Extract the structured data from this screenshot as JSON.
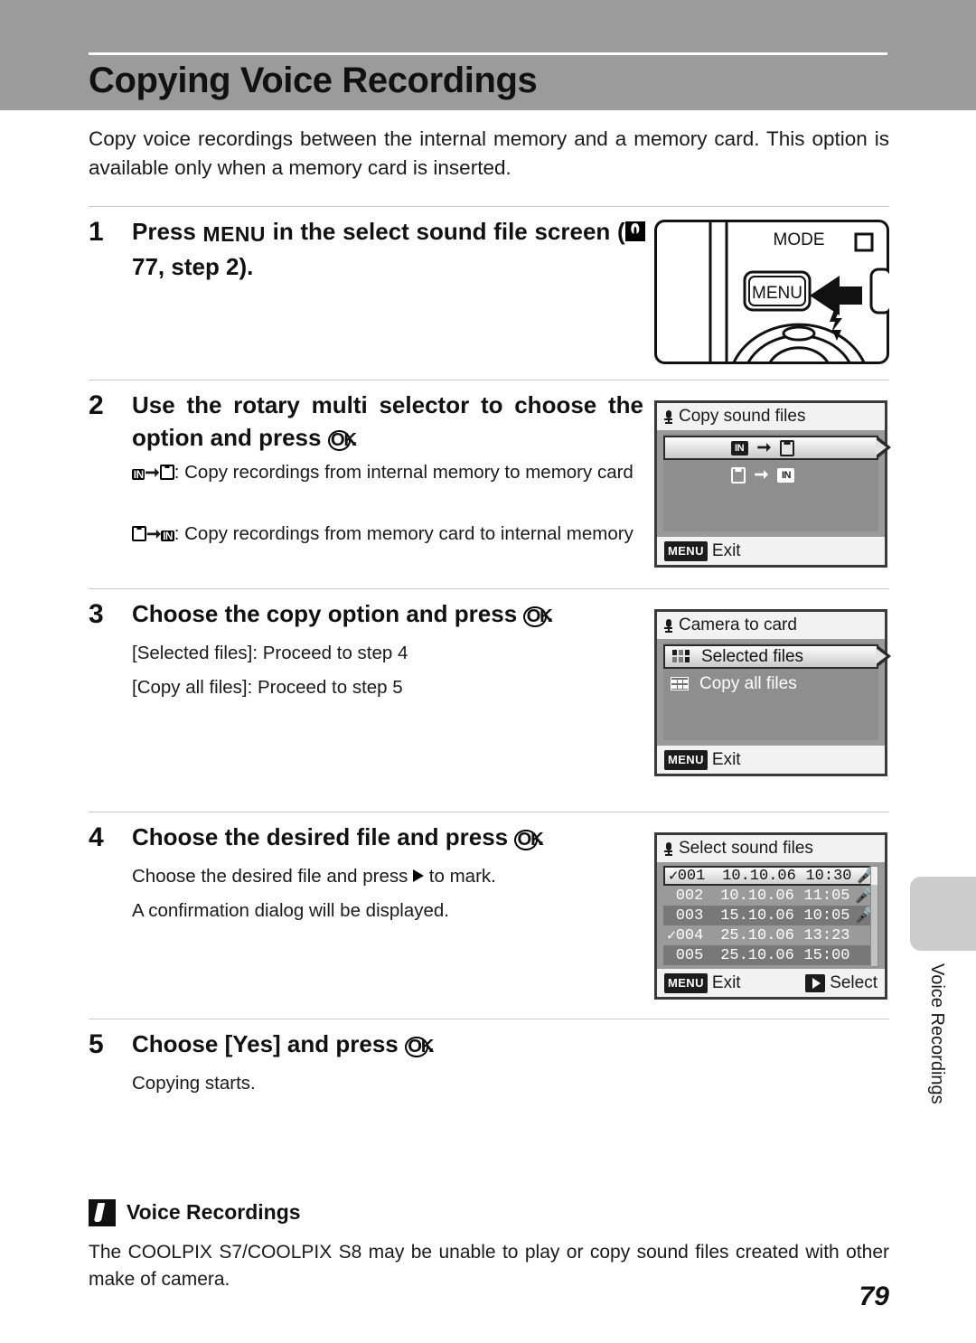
{
  "header": {
    "title": "Copying Voice Recordings"
  },
  "intro": "Copy voice recordings between the internal memory and a memory card. This option is available only when a memory card is inserted.",
  "steps": [
    {
      "number": "1",
      "head_before": "Press ",
      "head_menu": "MENU",
      "head_mid": " in the select sound file screen (",
      "head_ref": " 77, step 2).",
      "body": []
    },
    {
      "number": "2",
      "head_before": "Use the rotary multi selector to choose the option and press ",
      "head_ok": "OK",
      "head_after": ".",
      "body_1": ": Copy recordings from internal memory to memory card",
      "body_2": ": Copy recordings from memory card to internal memory"
    },
    {
      "number": "3",
      "head_before": "Choose the copy option and press ",
      "head_ok": "OK",
      "head_after": ".",
      "body_1": "[Selected files]: Proceed to step 4",
      "body_2": "[Copy all files]: Proceed to step 5"
    },
    {
      "number": "4",
      "head_before": "Choose the desired file and press ",
      "head_ok": "OK",
      "head_after": ".",
      "body_1a": "Choose the desired file and press ",
      "body_1b": " to mark.",
      "body_2": "A confirmation dialog will be displayed."
    },
    {
      "number": "5",
      "head_before": "Choose [Yes] and press ",
      "head_ok": "OK",
      "head_after": ".",
      "body_1": "Copying starts."
    }
  ],
  "camera_figure": {
    "mode_label": "MODE",
    "menu_button_label": "MENU"
  },
  "screen_copy_sound_files": {
    "title": "Copy sound files",
    "option_1_from": "IN",
    "option_1_to": "card",
    "option_2_from": "card",
    "option_2_to": "IN",
    "footer_badge": "MENU",
    "footer_label": "Exit"
  },
  "screen_camera_to_card": {
    "title": "Camera to card",
    "items": [
      "Selected files",
      "Copy all files"
    ],
    "footer_badge": "MENU",
    "footer_label": "Exit"
  },
  "screen_select_sound_files": {
    "title": "Select sound files",
    "columns": [
      "number",
      "date",
      "time",
      "mic"
    ],
    "rows": [
      {
        "number": "001",
        "date": "10.10.06",
        "time": "10:30",
        "mic": true,
        "checked": true,
        "selected": true
      },
      {
        "number": "002",
        "date": "10.10.06",
        "time": "11:05",
        "mic": true,
        "checked": false,
        "selected": false
      },
      {
        "number": "003",
        "date": "15.10.06",
        "time": "10:05",
        "mic": true,
        "checked": false,
        "selected": false
      },
      {
        "number": "004",
        "date": "25.10.06",
        "time": "13:23",
        "mic": false,
        "checked": true,
        "selected": false
      },
      {
        "number": "005",
        "date": "25.10.06",
        "time": "15:00",
        "mic": false,
        "checked": false,
        "selected": false
      }
    ],
    "footer_badge": "MENU",
    "footer_label": "Exit",
    "footer_select_label": "Select"
  },
  "side_tab": {
    "label": "Voice Recordings"
  },
  "note": {
    "title": "Voice Recordings",
    "body": "The COOLPIX S7/COOLPIX S8 may be unable to play or copy sound files created with other make of camera."
  },
  "page_number": "79"
}
